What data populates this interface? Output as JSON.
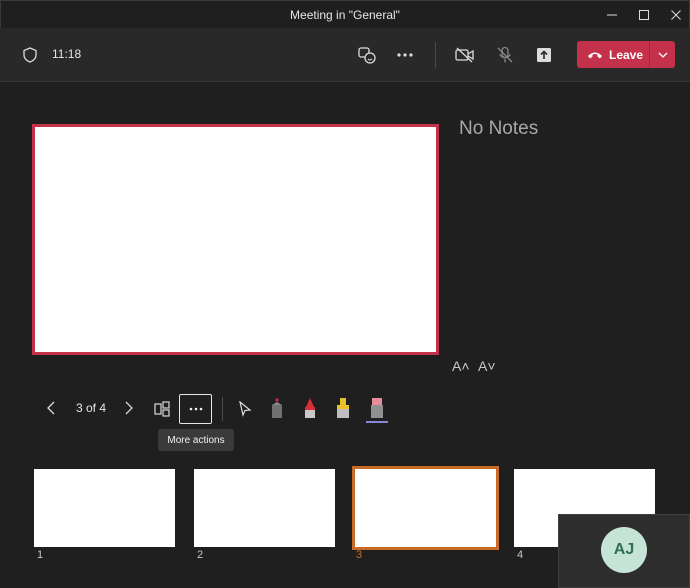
{
  "window": {
    "title": "Meeting in \"General\""
  },
  "toolbar": {
    "time": "11:18",
    "leave_label": "Leave",
    "leave_color": "#c4314b"
  },
  "stage": {
    "notes_text": "No Notes",
    "font_increase_label": "A˄",
    "font_decrease_label": "A˅",
    "pager_text": "3 of 4",
    "tooltip": "More actions",
    "thumbnails": [
      {
        "label": "1",
        "selected": false
      },
      {
        "label": "2",
        "selected": false
      },
      {
        "label": "3",
        "selected": true
      },
      {
        "label": "4",
        "selected": false
      }
    ],
    "selected_color": "#c86a28"
  },
  "self_view": {
    "initials": "AJ"
  },
  "icons": [
    "shield-icon",
    "reactions-icon",
    "more-icon",
    "camera-off-icon",
    "mic-off-icon",
    "share-icon",
    "phone-hangup-icon",
    "chevron-down-icon",
    "prev-icon",
    "next-icon",
    "thumbnails-icon",
    "laser-pointer-icon",
    "pen-icon",
    "highlighter-icon",
    "eraser-icon"
  ]
}
